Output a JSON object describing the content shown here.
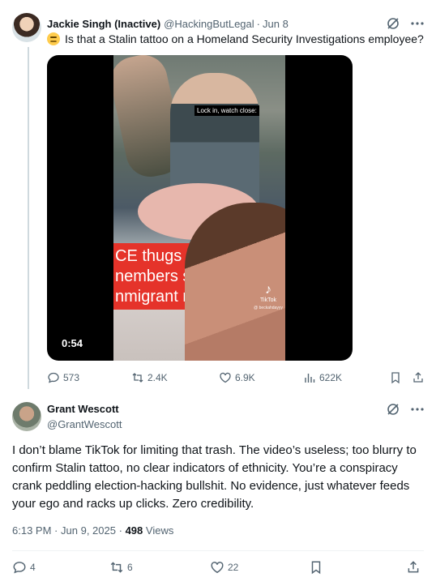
{
  "tweet1": {
    "author_name": "Jackie Singh (Inactive)",
    "handle": "@HackingButLegal",
    "separator": "·",
    "date": "Jun 8",
    "text": "Is that a Stalin tattoo on a Homeland Security Investigations employee?",
    "video": {
      "caption": "Lock in, watch close:",
      "banner_lines": [
        "CE thugs assa",
        "nembers star",
        "nmigrant rig"
      ],
      "watermark": "TikTok",
      "watermark_handle": "@ beckahdayyy",
      "duration": "0:54"
    },
    "stats": {
      "replies": "573",
      "reposts": "2.4K",
      "likes": "6.9K",
      "views": "622K"
    }
  },
  "tweet2": {
    "author_name": "Grant Wescott",
    "handle": "@GrantWescott",
    "text": "I don’t blame TikTok for limiting that trash. The video’s useless; too blurry to confirm Stalin tattoo, no clear indicators of ethnicity. You’re a conspiracy crank peddling election-hacking bullshit. No evidence, just whatever feeds your ego and racks up clicks. Zero credibility.",
    "time": "6:13 PM",
    "date": "Jun 9, 2025",
    "views_count": "498",
    "views_label": "Views",
    "stats": {
      "replies": "4",
      "reposts": "6",
      "likes": "22"
    }
  },
  "icons": {
    "reply": "reply-icon",
    "repost": "repost-icon",
    "like": "heart-icon",
    "views": "views-icon",
    "bookmark": "bookmark-icon",
    "share": "share-icon",
    "grok": "grok-icon",
    "more": "more-icon",
    "thinking": "thinking-face-emoji"
  },
  "colors": {
    "text": "#0f1419",
    "secondary": "#536471",
    "divider": "#eff3f4",
    "thread_line": "#cfd9de",
    "banner": "#e5332a"
  }
}
